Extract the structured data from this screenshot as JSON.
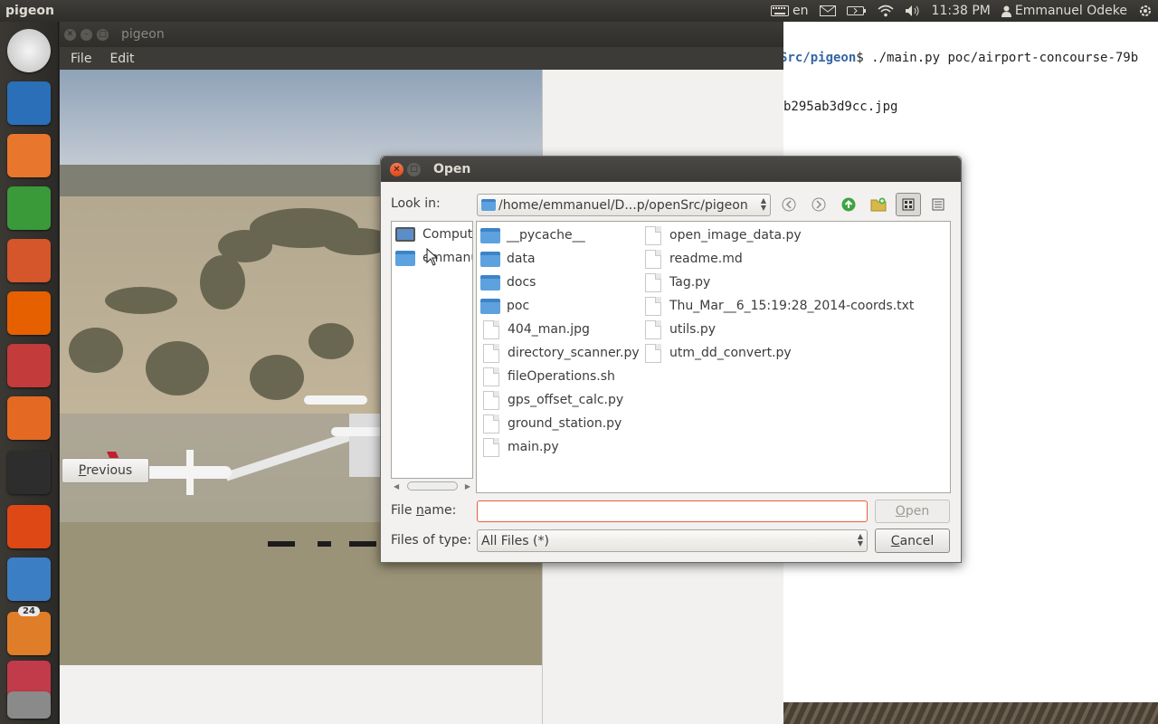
{
  "top_panel": {
    "app_name": "pigeon",
    "keyboard": "en",
    "clock": "11:38 PM",
    "user": "Emmanuel Odeke"
  },
  "launcher": {
    "items": [
      {
        "name": "dash-home-icon",
        "color": "#e0e0e0"
      },
      {
        "name": "libreoffice-writer-icon",
        "color": "#2a6fb7"
      },
      {
        "name": "files-icon",
        "color": "#e8762d"
      },
      {
        "name": "libreoffice-calc-icon",
        "color": "#3a9a3a"
      },
      {
        "name": "libreoffice-impress-icon",
        "color": "#d4562a"
      },
      {
        "name": "firefox-icon",
        "color": "#e66000"
      },
      {
        "name": "system-settings-icon",
        "color": "#c43b3b"
      },
      {
        "name": "software-center-icon",
        "color": "#e46a24"
      },
      {
        "name": "terminal-icon",
        "color": "#2d2d2d"
      },
      {
        "name": "ubuntu-one-icon",
        "color": "#dd4814"
      },
      {
        "name": "chromium-icon",
        "color": "#3c7ec4"
      },
      {
        "name": "update-manager-icon",
        "color": "#e07d28",
        "badge": "24"
      },
      {
        "name": "app-icon",
        "color": "#c23b4a"
      },
      {
        "name": "trash-icon",
        "color": "#8a8a8a"
      }
    ]
  },
  "terminal": {
    "prompt_path": "Src/pigeon",
    "command": "$ ./main.py poc/airport-concourse-79b",
    "output_line": "b295ab3d9cc.jpg"
  },
  "pigeon": {
    "title": "pigeon",
    "menu": [
      "File",
      "Edit"
    ],
    "previous_button": "Previous",
    "previous_mnemonic": "P",
    "previous_rest": "revious"
  },
  "dialog": {
    "title": "Open",
    "look_in_label": "Look in:",
    "look_in_path": "/home/emmanuel/D...p/openSrc/pigeon",
    "sidebar": [
      "Computer",
      "emmanuel"
    ],
    "folders": [
      "__pycache__",
      "data",
      "docs",
      "poc"
    ],
    "files_col1": [
      "404_man.jpg",
      "directory_scanner.py",
      "fileOperations.sh",
      "gps_offset_calc.py",
      "ground_station.py",
      "main.py"
    ],
    "files_col2": [
      "open_image_data.py",
      "readme.md",
      "Tag.py",
      "Thu_Mar__6_15:19:28_2014-coords.txt",
      "utils.py",
      "utm_dd_convert.py"
    ],
    "file_name_label_a": "File ",
    "file_name_label_m": "n",
    "file_name_label_b": "ame:",
    "file_name_value": "",
    "files_of_type_label": "Files of type:",
    "files_of_type_value": "All Files (*)",
    "open_button": "Open",
    "open_mnemonic": "O",
    "open_rest": "pen",
    "cancel_mnemonic": "C",
    "cancel_rest": "ancel"
  },
  "colors": {
    "panel": "#3c3b37",
    "accent_orange": "#e8603a",
    "close_button": "#df4a16"
  }
}
